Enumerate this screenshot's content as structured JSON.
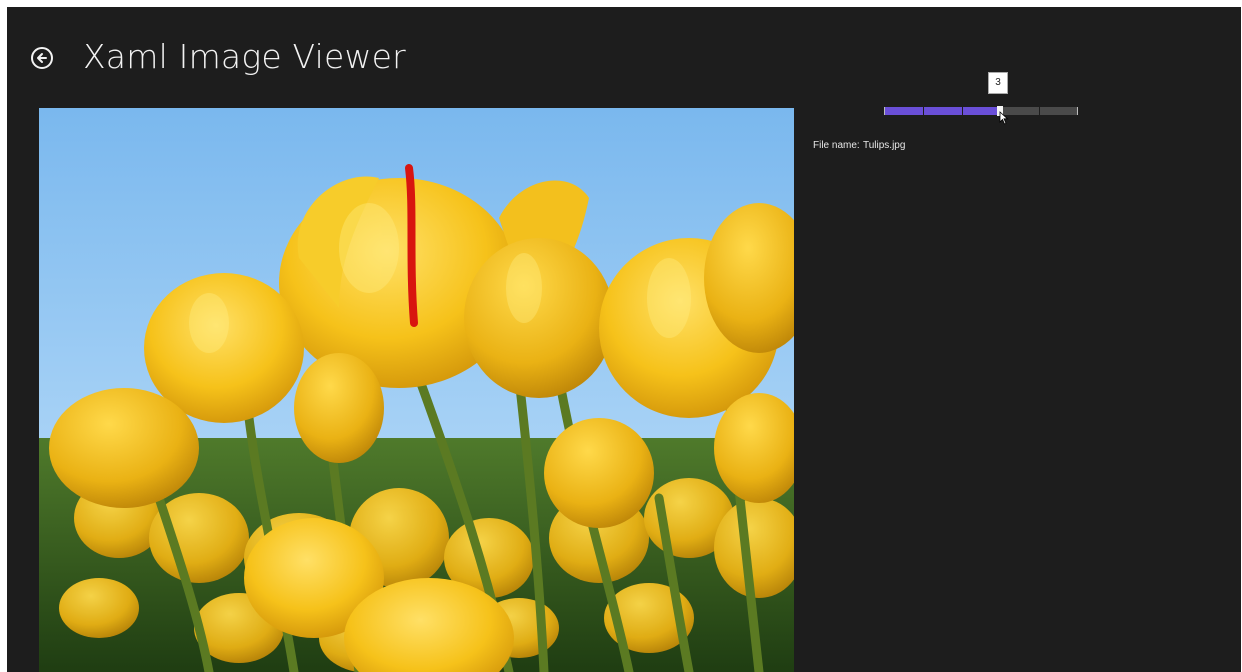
{
  "app": {
    "title": "Xaml Image Viewer",
    "back_icon": "back-arrow-circle-icon"
  },
  "image": {
    "subject": "yellow tulips against a blue sky"
  },
  "slider": {
    "value": 3,
    "min": 0,
    "max": 5,
    "tooltip": "3",
    "fill_color": "#6a4fd8",
    "track_color": "#4a4a4a"
  },
  "file_info": {
    "label": "File name:",
    "value": "Tulips.jpg"
  }
}
